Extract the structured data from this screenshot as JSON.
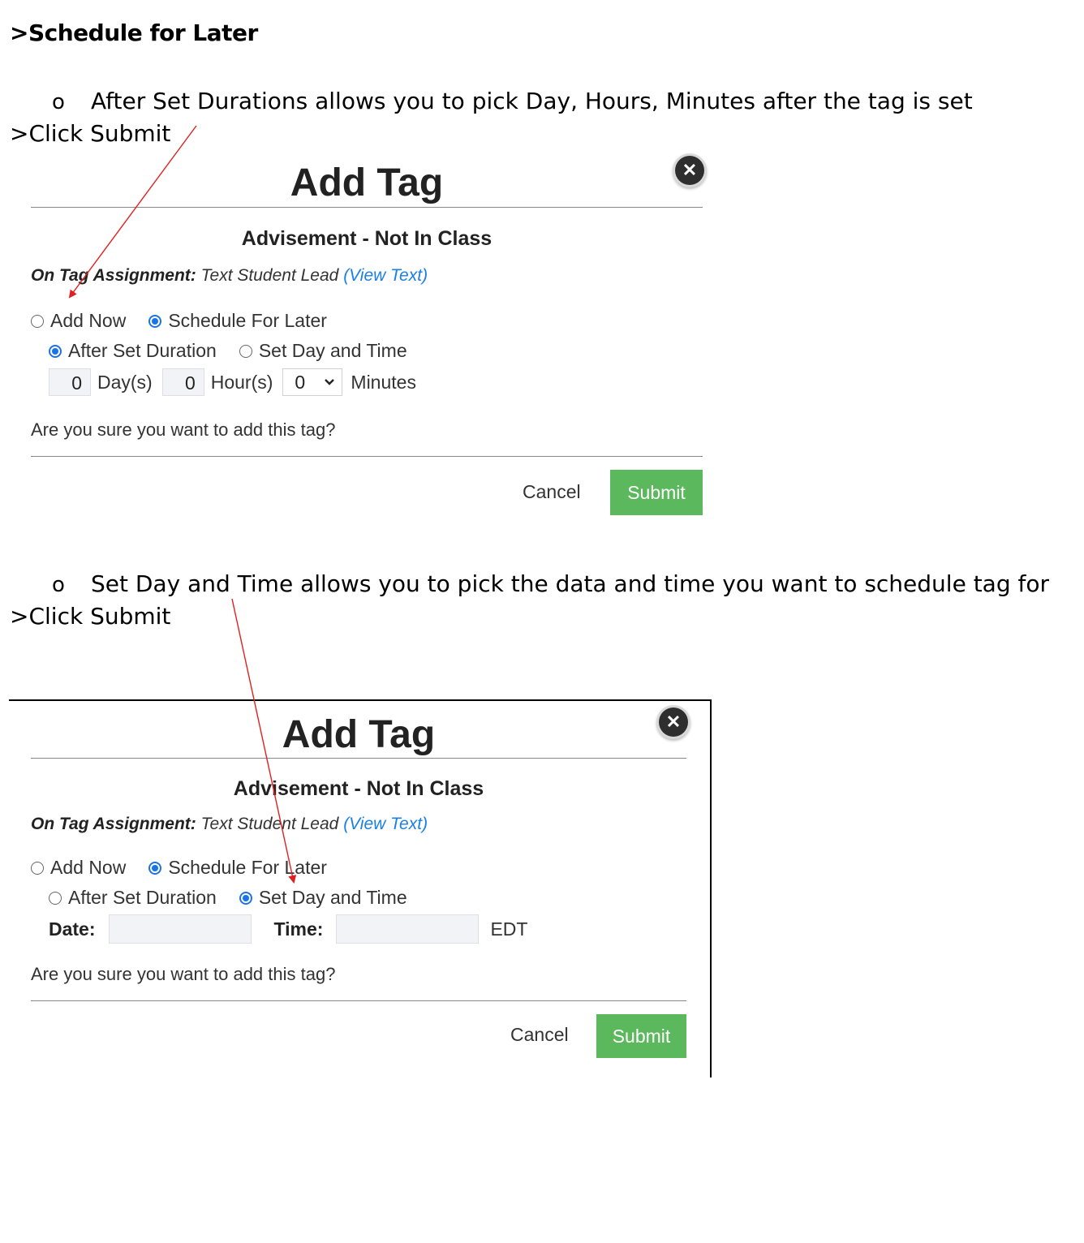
{
  "heading": ">Schedule for Later",
  "section1": {
    "bullet_mark": "o",
    "bullet_text": "After Set Durations allows you to pick Day, Hours, Minutes after the tag is set",
    "instruction": ">Click Submit"
  },
  "section2": {
    "bullet_mark": "o",
    "bullet_text": "Set Day and Time allows you to pick the data and time you want to schedule tag for",
    "instruction": ">Click Submit"
  },
  "modal1": {
    "title": "Add Tag",
    "close_glyph": "✕",
    "subtitle": "Advisement - Not In Class",
    "assign_label": "On Tag Assignment:",
    "assign_value": "Text Student Lead",
    "assign_link": "(View Text)",
    "mode_options": [
      "Add Now",
      "Schedule For Later"
    ],
    "mode_selected": "Schedule For Later",
    "timing_options": [
      "After Set Duration",
      "Set Day and Time"
    ],
    "timing_selected": "After Set Duration",
    "days_value": "0",
    "days_label": "Day(s)",
    "hours_value": "0",
    "hours_label": "Hour(s)",
    "minutes_value": "0",
    "minutes_label": "Minutes",
    "confirm": "Are you sure you want to add this tag?",
    "cancel": "Cancel",
    "submit": "Submit",
    "submit_color": "#5cb85c"
  },
  "modal2": {
    "title": "Add Tag",
    "close_glyph": "✕",
    "subtitle": "Advisement - Not In Class",
    "assign_label": "On Tag Assignment:",
    "assign_value": "Text Student Lead",
    "assign_link": "(View Text)",
    "mode_options": [
      "Add Now",
      "Schedule For Later"
    ],
    "mode_selected": "Schedule For Later",
    "timing_options": [
      "After Set Duration",
      "Set Day and Time"
    ],
    "timing_selected": "Set Day and Time",
    "date_label": "Date:",
    "date_value": "",
    "time_label": "Time:",
    "time_value": "",
    "timezone": "EDT",
    "confirm": "Are you sure you want to add this tag?",
    "cancel": "Cancel",
    "submit": "Submit",
    "submit_color": "#5cb85c"
  },
  "colors": {
    "link": "#1a7fe6",
    "radio_selected": "#1a73e8",
    "annotation_arrow": "#e02020"
  }
}
